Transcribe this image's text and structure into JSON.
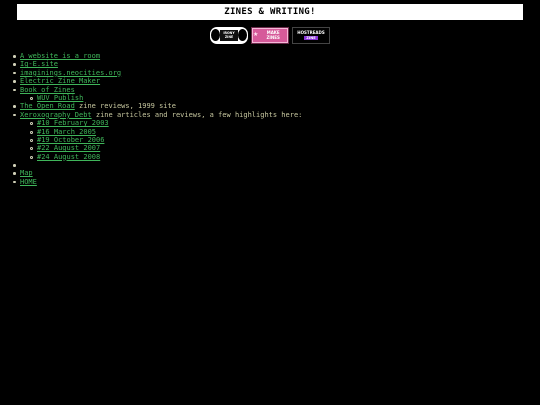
{
  "title": "ZINES & WRITING!",
  "badges": [
    {
      "name": "badge-1",
      "text": "IRONY ZINE"
    },
    {
      "name": "badge-2",
      "text": "MAKE ZINES"
    },
    {
      "name": "badge-3",
      "top": "HOSTREADS",
      "bottom": "ZINE"
    }
  ],
  "links": {
    "website_is_room": "A website is a room",
    "ig_site": "Ig-E.site",
    "imaginings": "imaginings.neocities.org",
    "electric_zine_maker": "Electric Zine Maker",
    "book_of_zines": "Book of Zines",
    "wuv_publish": "WUV Publish",
    "open_road": "The Open Road",
    "open_road_note": " zine reviews, 1999 site",
    "xeroxography": "Xeroxography Debt",
    "xeroxography_note": " zine articles and reviews, a few highlights here:",
    "issues": [
      "#10 February 2003",
      "#16 March 2005",
      "#19 October 2006",
      "#22 August 2007",
      "#24 August 2008"
    ],
    "map": "Map",
    "home": "HOME"
  },
  "colors": {
    "background": "#000000",
    "link": "#3fb55a",
    "text": "#c8c8a0",
    "title_bg": "#ffffff"
  }
}
